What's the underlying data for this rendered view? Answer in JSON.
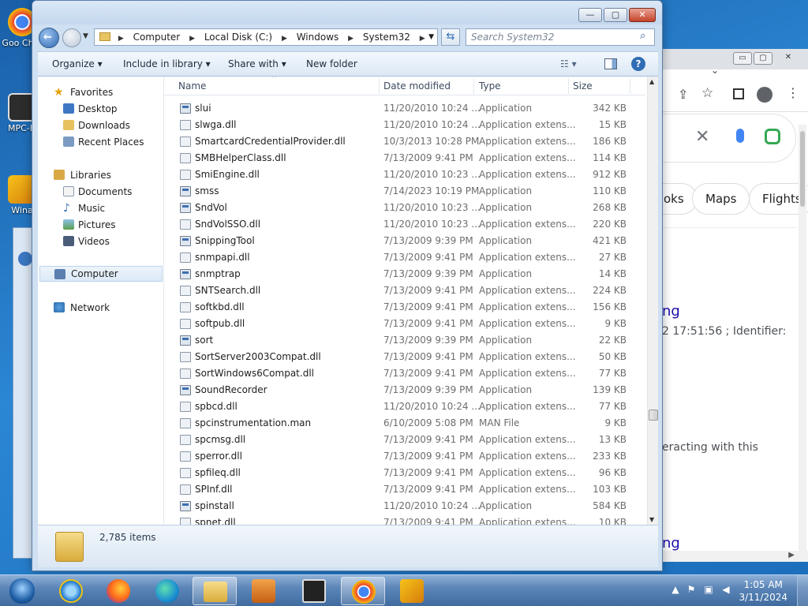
{
  "desktop": {
    "icons": [
      {
        "label": "Goo Chro",
        "icon": "chrome-icon"
      },
      {
        "label": "MPC-H",
        "icon": "mpc-hc-icon"
      },
      {
        "label": "Wina",
        "icon": "winamp-icon"
      }
    ]
  },
  "chrome_window": {
    "controls": {
      "minimize": "▭",
      "maximize": "▢",
      "close": "✕"
    },
    "pills": [
      "oks",
      "Maps",
      "Flights"
    ],
    "result_title": "ng",
    "result_meta": "2 17:51:56 ; Identifier:",
    "snippet": "eracting with this",
    "bottom_text": "ng"
  },
  "explorer": {
    "caption_buttons": {
      "minimize": "—",
      "maximize": "▢",
      "close": "✕"
    },
    "breadcrumb": [
      "Computer",
      "Local Disk (C:)",
      "Windows",
      "System32"
    ],
    "search_placeholder": "Search System32",
    "commands": {
      "organize": "Organize",
      "include": "Include in library",
      "share": "Share with",
      "newfolder": "New folder"
    },
    "nav": {
      "favorites": "Favorites",
      "desktop": "Desktop",
      "downloads": "Downloads",
      "recent": "Recent Places",
      "libraries": "Libraries",
      "documents": "Documents",
      "music": "Music",
      "pictures": "Pictures",
      "videos": "Videos",
      "computer": "Computer",
      "network": "Network"
    },
    "columns": {
      "name": "Name",
      "date": "Date modified",
      "type": "Type",
      "size": "Size"
    },
    "files": [
      {
        "name": "slui",
        "date": "11/20/2010 10:24 ...",
        "type": "Application",
        "size": "342 KB",
        "kind": "app"
      },
      {
        "name": "slwga.dll",
        "date": "11/20/2010 10:24 ...",
        "type": "Application extens...",
        "size": "15 KB",
        "kind": "dll"
      },
      {
        "name": "SmartcardCredentialProvider.dll",
        "date": "10/3/2013 10:28 PM",
        "type": "Application extens...",
        "size": "186 KB",
        "kind": "dll"
      },
      {
        "name": "SMBHelperClass.dll",
        "date": "7/13/2009 9:41 PM",
        "type": "Application extens...",
        "size": "114 KB",
        "kind": "dll"
      },
      {
        "name": "SmiEngine.dll",
        "date": "11/20/2010 10:23 ...",
        "type": "Application extens...",
        "size": "912 KB",
        "kind": "dll"
      },
      {
        "name": "smss",
        "date": "7/14/2023 10:19 PM",
        "type": "Application",
        "size": "110 KB",
        "kind": "app"
      },
      {
        "name": "SndVol",
        "date": "11/20/2010 10:23 ...",
        "type": "Application",
        "size": "268 KB",
        "kind": "app"
      },
      {
        "name": "SndVolSSO.dll",
        "date": "11/20/2010 10:23 ...",
        "type": "Application extens...",
        "size": "220 KB",
        "kind": "dll"
      },
      {
        "name": "SnippingTool",
        "date": "7/13/2009 9:39 PM",
        "type": "Application",
        "size": "421 KB",
        "kind": "app"
      },
      {
        "name": "snmpapi.dll",
        "date": "7/13/2009 9:41 PM",
        "type": "Application extens...",
        "size": "27 KB",
        "kind": "dll"
      },
      {
        "name": "snmptrap",
        "date": "7/13/2009 9:39 PM",
        "type": "Application",
        "size": "14 KB",
        "kind": "app"
      },
      {
        "name": "SNTSearch.dll",
        "date": "7/13/2009 9:41 PM",
        "type": "Application extens...",
        "size": "224 KB",
        "kind": "dll"
      },
      {
        "name": "softkbd.dll",
        "date": "7/13/2009 9:41 PM",
        "type": "Application extens...",
        "size": "156 KB",
        "kind": "dll"
      },
      {
        "name": "softpub.dll",
        "date": "7/13/2009 9:41 PM",
        "type": "Application extens...",
        "size": "9 KB",
        "kind": "dll"
      },
      {
        "name": "sort",
        "date": "7/13/2009 9:39 PM",
        "type": "Application",
        "size": "22 KB",
        "kind": "app"
      },
      {
        "name": "SortServer2003Compat.dll",
        "date": "7/13/2009 9:41 PM",
        "type": "Application extens...",
        "size": "50 KB",
        "kind": "dll"
      },
      {
        "name": "SortWindows6Compat.dll",
        "date": "7/13/2009 9:41 PM",
        "type": "Application extens...",
        "size": "77 KB",
        "kind": "dll"
      },
      {
        "name": "SoundRecorder",
        "date": "7/13/2009 9:39 PM",
        "type": "Application",
        "size": "139 KB",
        "kind": "app"
      },
      {
        "name": "spbcd.dll",
        "date": "11/20/2010 10:24 ...",
        "type": "Application extens...",
        "size": "77 KB",
        "kind": "dll"
      },
      {
        "name": "spcinstrumentation.man",
        "date": "6/10/2009 5:08 PM",
        "type": "MAN File",
        "size": "9 KB",
        "kind": "file"
      },
      {
        "name": "spcmsg.dll",
        "date": "7/13/2009 9:41 PM",
        "type": "Application extens...",
        "size": "13 KB",
        "kind": "dll"
      },
      {
        "name": "sperror.dll",
        "date": "7/13/2009 9:41 PM",
        "type": "Application extens...",
        "size": "233 KB",
        "kind": "dll"
      },
      {
        "name": "spfileq.dll",
        "date": "7/13/2009 9:41 PM",
        "type": "Application extens...",
        "size": "96 KB",
        "kind": "dll"
      },
      {
        "name": "SPInf.dll",
        "date": "7/13/2009 9:41 PM",
        "type": "Application extens...",
        "size": "103 KB",
        "kind": "dll"
      },
      {
        "name": "spinstall",
        "date": "11/20/2010 10:24 ...",
        "type": "Application",
        "size": "584 KB",
        "kind": "app"
      },
      {
        "name": "spnet.dll",
        "date": "7/13/2009 9:41 PM",
        "type": "Application extens...",
        "size": "10 KB",
        "kind": "dll"
      }
    ],
    "status": {
      "items": "2,785 items"
    }
  },
  "taskbar": {
    "apps": [
      "start-orb",
      "internet-explorer-icon",
      "firefox-icon",
      "edge-icon",
      "windows-explorer-icon",
      "media-player-icon",
      "mpc-hc-icon",
      "chrome-icon",
      "winamp-icon"
    ],
    "time": "1:05 AM",
    "date": "3/11/2024"
  },
  "colors": {
    "accent": "#3a74c0",
    "selection": "#dce9f7",
    "taskbar": "#5c86b8"
  }
}
